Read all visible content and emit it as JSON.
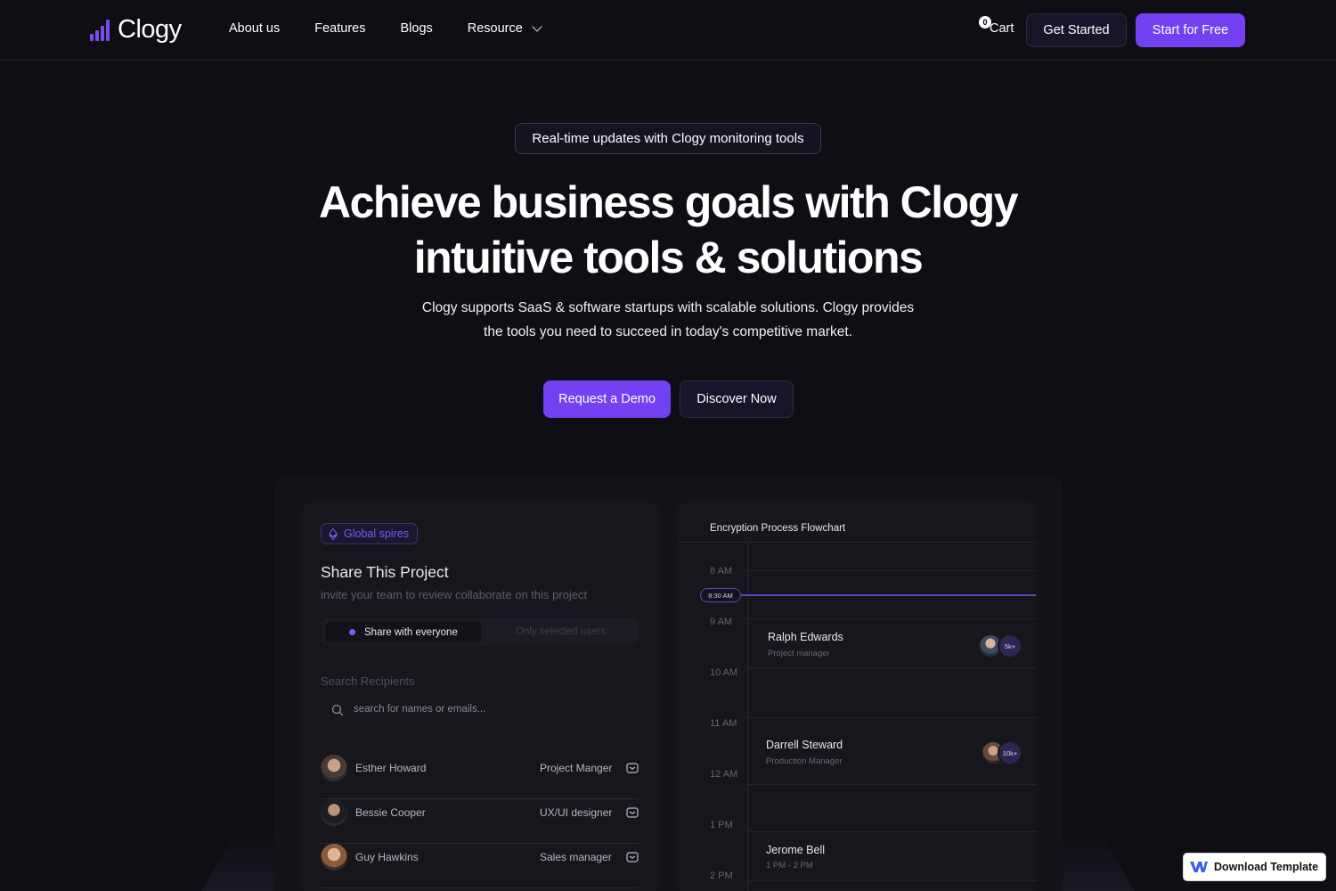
{
  "nav": {
    "brand": "Clogy",
    "links": [
      "About us",
      "Features",
      "Blogs",
      "Resource"
    ],
    "cart_count": "0",
    "cart_label": "Cart",
    "get_started": "Get Started",
    "start_free": "Start for Free"
  },
  "hero": {
    "pill": "Real-time updates with Clogy monitoring tools",
    "title_line1": "Achieve business goals with Clogy",
    "title_line2": "intuitive tools & solutions",
    "sub_line1": "Clogy supports SaaS & software startups with scalable solutions. Clogy provides",
    "sub_line2": "the tools you need to succeed in today's competitive market.",
    "demo_button": "Request a Demo",
    "discover_button": "Discover Now"
  },
  "share_card": {
    "tag": "Global spires",
    "title": "Share This Project",
    "subtitle": "invite your team to review collaborate on this project",
    "toggle_on": "Share with everyone",
    "toggle_off": "Only selected users",
    "search_label": "Search Recipients",
    "search_placeholder": "search for names or emails...",
    "recipients": [
      {
        "name": "Esther Howard",
        "role": "Project Manger"
      },
      {
        "name": "Bessie Cooper",
        "role": "UX/UI designer"
      },
      {
        "name": "Guy Hawkins",
        "role": "Sales manager"
      }
    ]
  },
  "flowchart": {
    "title": "Encryption Process Flowchart",
    "now_label": "8:30 AM",
    "times": [
      "8 AM",
      "9 AM",
      "10 AM",
      "11 AM",
      "12 AM",
      "1 PM",
      "2 PM"
    ],
    "events": [
      {
        "name": "Ralph Edwards",
        "detail": "Project manager",
        "count": "5k+"
      },
      {
        "name": "Darrell Steward",
        "detail": "Production Manager",
        "count": "10k+"
      },
      {
        "name": "Jerome Bell",
        "detail": "1 PM - 2 PM"
      }
    ]
  },
  "download": {
    "label": "Download Template"
  },
  "colors": {
    "accent": "#7340f2",
    "background": "#0f0e14"
  }
}
